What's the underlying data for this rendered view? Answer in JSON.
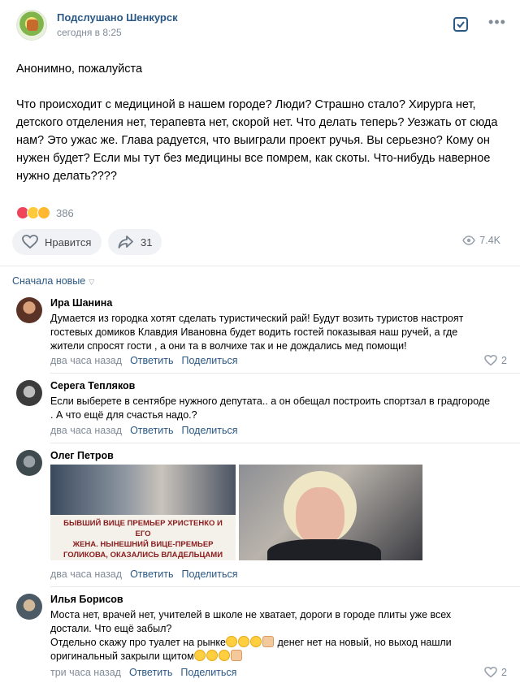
{
  "post": {
    "group_name": "Подслушано Шенкурск",
    "time": "сегодня в 8:25",
    "text": "Анонимно, пожалуйста\n\nЧто происходит с медициной в нашем городе? Люди? Страшно стало? Хирурга нет, детского отделения нет, терапевта нет, скорой нет. Что делать теперь? Уезжать от сюда нам? Это ужас же. Глава радуется, что выиграли проект ручья. Вы серьезно? Кому он нужен будет? Если мы тут без медицины все помрем, как скоты. Что-нибудь наверное нужно делать????",
    "reaction_count": "386",
    "like_label": "Нравится",
    "share_count": "31",
    "views": "7.4K"
  },
  "sort": {
    "label": "Сначала новые"
  },
  "comments": [
    {
      "author": "Ира Шанина",
      "text": "Думается из городка хотят сделать туристический рай! Будут возить туристов настроят гостевых домиков Клавдия Ивановна будет водить гостей показывая наш ручей, а где жители спросят гости , а они та в волчихе так и не дождались мед помощи!",
      "time": "два часа назад",
      "reply": "Ответить",
      "share": "Поделиться",
      "likes": "2"
    },
    {
      "author": "Серега Тепляков",
      "text": "Если выберете в сентябре нужного депутата.. а он обещал построить спортзал в градгороде . А что ещё для счастья надо.?",
      "time": "два часа назад",
      "reply": "Ответить",
      "share": "Поделиться"
    },
    {
      "author": "Олег Петров",
      "image_caption": [
        "БЫВШИЙ ВИЦЕ ПРЕМЬЕР ХРИСТЕНКО И ЕГО",
        "ЖЕНА. НЫНЕШНИЙ ВИЦЕ-ПРЕМЬЕР",
        "ГОЛИКОВА, ОКАЗАЛИСЬ ВЛАДЕЛЬЦАМИ"
      ],
      "time": "два часа назад",
      "reply": "Ответить",
      "share": "Поделиться"
    },
    {
      "author": "Илья Борисов",
      "text_line1": "Моста нет, врачей нет, учителей в школе не хватает, дороги в городе плиты уже всех достали. Что ещё забыл?",
      "text_line2a": "Отдельно скажу про туалет на рынке",
      "text_line2b": " денег нет на новый, но выход нашли оригинальный закрыли щитом",
      "time": "три часа назад",
      "reply": "Ответить",
      "share": "Поделиться",
      "likes": "2"
    }
  ],
  "colors": {
    "link": "#2a5885",
    "muted": "#818c99",
    "button_bg": "#f0f2f5",
    "divider": "#e7e8ec"
  }
}
